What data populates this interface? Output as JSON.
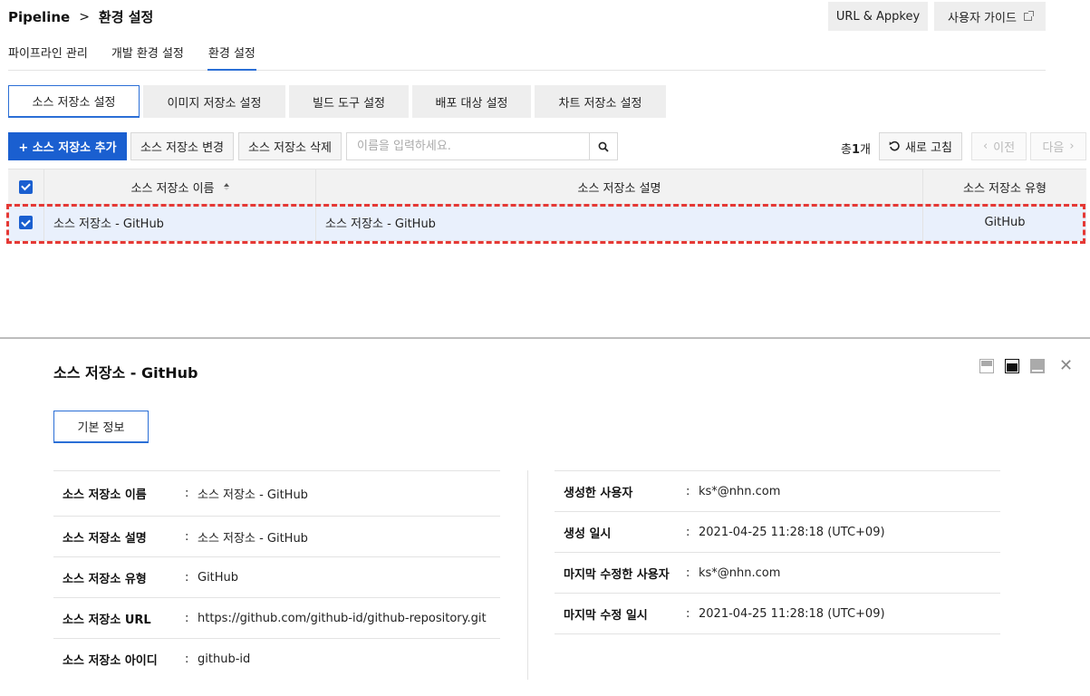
{
  "breadcrumb": {
    "root": "Pipeline",
    "separator": ">",
    "current": "환경 설정"
  },
  "header_buttons": {
    "url_appkey": "URL & Appkey",
    "user_guide": "사용자 가이드"
  },
  "top_tabs": [
    {
      "label": "파이프라인 관리",
      "active": false
    },
    {
      "label": "개발 환경 설정",
      "active": false
    },
    {
      "label": "환경 설정",
      "active": true
    }
  ],
  "sub_tabs": [
    {
      "label": "소스 저장소 설정",
      "active": true
    },
    {
      "label": "이미지 저장소 설정",
      "active": false
    },
    {
      "label": "빌드 도구 설정",
      "active": false
    },
    {
      "label": "배포 대상 설정",
      "active": false
    },
    {
      "label": "차트 저장소 설정",
      "active": false
    }
  ],
  "toolbar": {
    "add_label": "+ 소스 저장소 추가",
    "edit_label": "소스 저장소 변경",
    "delete_label": "소스 저장소 삭제",
    "search_placeholder": "이름을 입력하세요.",
    "total_prefix": "총",
    "total_count": "1",
    "total_suffix": "개",
    "refresh_label": "새로 고침",
    "prev_label": "이전",
    "next_label": "다음"
  },
  "table": {
    "columns": [
      "소스 저장소 이름",
      "소스 저장소 설명",
      "소스 저장소 유형"
    ],
    "rows": [
      {
        "checked": true,
        "name": "소스 저장소 - GitHub",
        "description": "소스 저장소 - GitHub",
        "type": "GitHub"
      }
    ]
  },
  "detail": {
    "title": "소스 저장소 - GitHub",
    "tab_label": "기본 정보",
    "left": [
      {
        "label": "소스 저장소 이름",
        "value": "소스 저장소 - GitHub"
      },
      {
        "label": "소스 저장소 설명",
        "value": "소스 저장소 - GitHub"
      },
      {
        "label": "소스 저장소 유형",
        "value": "GitHub"
      },
      {
        "label": "소스 저장소 URL",
        "value": "https://github.com/github-id/github-repository.git"
      },
      {
        "label": "소스 저장소 아이디",
        "value": "github-id"
      }
    ],
    "right": [
      {
        "label": "생성한 사용자",
        "value": "ks*@nhn.com"
      },
      {
        "label": "생성 일시",
        "value": "2021-04-25 11:28:18 (UTC+09)"
      },
      {
        "label": "마지막 수정한 사용자",
        "value": "ks*@nhn.com"
      },
      {
        "label": "마지막 수정 일시",
        "value": "2021-04-25 11:28:18 (UTC+09)"
      }
    ]
  },
  "colors": {
    "accent": "#1a5fd0",
    "highlight": "#e53935",
    "row_selected": "#e9f0fc"
  }
}
